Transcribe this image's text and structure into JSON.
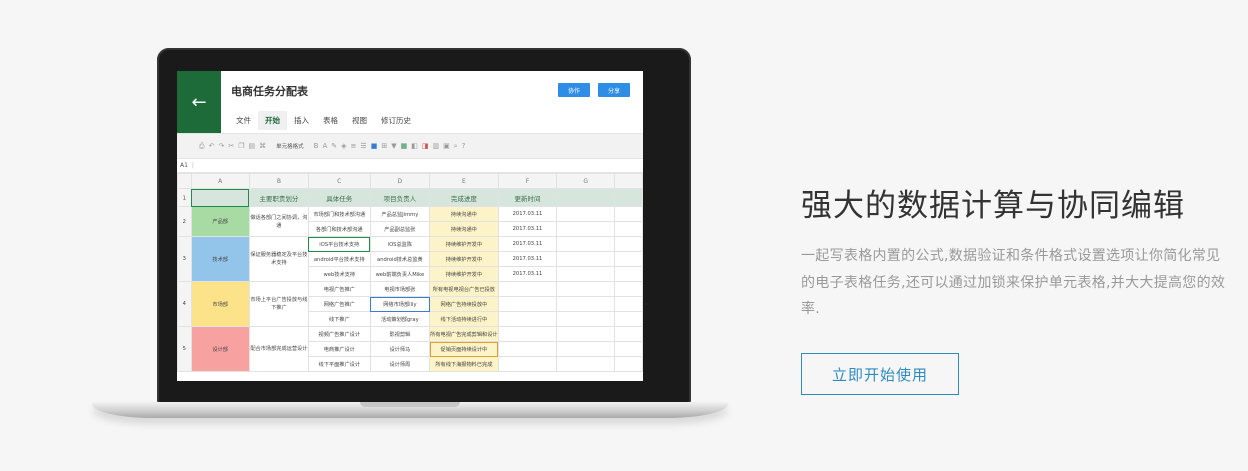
{
  "app": {
    "title": "电商任务分配表",
    "back_icon": "arrow-left-icon",
    "buttons": {
      "collab": "协作",
      "share": "分享"
    },
    "menu": [
      "文件",
      "开始",
      "插入",
      "表格",
      "视图",
      "修订历史"
    ],
    "active_menu": "开始",
    "toolbar": {
      "format_select": "单元格格式"
    },
    "formula_bar": {
      "cell": "A1"
    }
  },
  "sheet": {
    "columns": [
      "A",
      "B",
      "C",
      "D",
      "E",
      "F",
      "G"
    ],
    "header_row": [
      "",
      "主要职责划分",
      "具体任务",
      "项目负责人",
      "完成进度",
      "更新时间",
      ""
    ],
    "groups": [
      {
        "row": "2",
        "dept": "产品部",
        "dept_color": "#a8dba4",
        "desc": "做话各部门之间协调，沟通",
        "tasks": [
          {
            "task": "市场部门和技术部沟通",
            "owner": "产品总监Jimmy",
            "progress": "持续沟通中",
            "date": "2017.03.11"
          },
          {
            "task": "各部门和技术部沟通",
            "owner": "产品副总监张",
            "progress": "持续沟通中",
            "date": "2017.03.11"
          }
        ]
      },
      {
        "row": "3",
        "dept": "技术部",
        "dept_color": "#93c5ea",
        "desc": "保证服务器稳定及平台技术支持",
        "tasks": [
          {
            "task": "iOS平台技术支持",
            "owner": "iOS总监陈",
            "progress": "持续维护开发中",
            "date": "2017.03.11"
          },
          {
            "task": "android平台技术支持",
            "owner": "android技术总监黄",
            "progress": "持续维护开发中",
            "date": "2017.03.11"
          },
          {
            "task": "web技术支持",
            "owner": "web前端负责人Mike",
            "progress": "持续维护开发中",
            "date": "2017.03.11"
          }
        ]
      },
      {
        "row": "4",
        "dept": "市场部",
        "dept_color": "#fce38a",
        "desc": "市场上平台广告投放与线下推广",
        "tasks": [
          {
            "task": "电视广告推广",
            "owner": "电视市场部张",
            "progress": "所有电视电视台广告已投放",
            "date": ""
          },
          {
            "task": "网络广告推广",
            "owner": "网络市场部lily",
            "progress": "网络广告持续投放中",
            "date": ""
          },
          {
            "task": "线下推广",
            "owner": "活动策划部gray",
            "progress": "线下活动持续进行中",
            "date": ""
          }
        ]
      },
      {
        "row": "5",
        "dept": "设计部",
        "dept_color": "#f7a1a1",
        "desc": "配合市场部完成运营设计",
        "tasks": [
          {
            "task": "视频广告推广设计",
            "owner": "影视剪辑",
            "progress": "所有电视广告完成剪辑和设计",
            "date": ""
          },
          {
            "task": "电商推广设计",
            "owner": "设计师马",
            "progress": "促销页面持续设计中",
            "date": ""
          },
          {
            "task": "线下平面推广设计",
            "owner": "设计师周",
            "progress": "所有线下海报物料已完成",
            "date": ""
          }
        ]
      }
    ]
  },
  "content": {
    "headline": "强大的数据计算与协同编辑",
    "description": "一起写表格内置的公式,数据验证和条件格式设置选项让你简化常见的电子表格任务,还可以通过加锁来保护单元表格,并大大提高您的效率.",
    "cta": "立即开始使用",
    "accent_color": "#2d8bbf"
  }
}
